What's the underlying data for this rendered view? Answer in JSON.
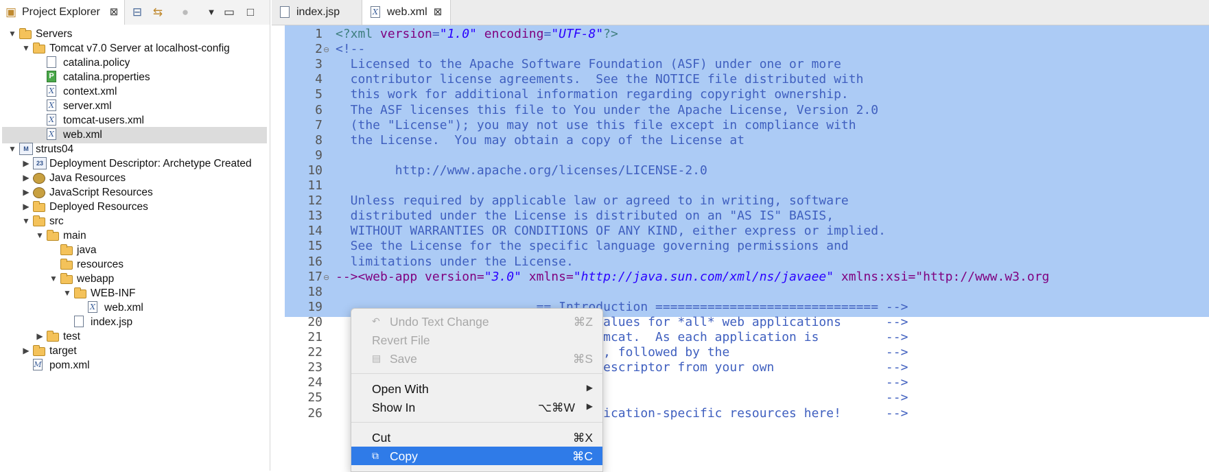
{
  "explorer": {
    "tab_label": "Project Explorer",
    "tree": [
      {
        "label": "Servers",
        "icon": "folder-icon",
        "level": 0,
        "tw": "down"
      },
      {
        "label": "Tomcat v7.0 Server at localhost-config",
        "icon": "folder-icon",
        "level": 1,
        "tw": "down"
      },
      {
        "label": "catalina.policy",
        "icon": "file-icon",
        "level": 2,
        "tw": ""
      },
      {
        "label": "catalina.properties",
        "icon": "properties-file-icon",
        "level": 2,
        "tw": ""
      },
      {
        "label": "context.xml",
        "icon": "xml-file-icon",
        "level": 2,
        "tw": ""
      },
      {
        "label": "server.xml",
        "icon": "xml-file-icon",
        "level": 2,
        "tw": ""
      },
      {
        "label": "tomcat-users.xml",
        "icon": "xml-file-icon",
        "level": 2,
        "tw": ""
      },
      {
        "label": "web.xml",
        "icon": "xml-file-icon",
        "level": 2,
        "tw": "",
        "selected": true
      },
      {
        "label": "struts04",
        "icon": "maven-project-icon",
        "level": 0,
        "tw": "down"
      },
      {
        "label": "Deployment Descriptor: Archetype Created",
        "icon": "deployment-descriptor-icon",
        "level": 1,
        "tw": "right"
      },
      {
        "label": "Java Resources",
        "icon": "java-resources-icon",
        "level": 1,
        "tw": "right"
      },
      {
        "label": "JavaScript Resources",
        "icon": "javascript-resources-icon",
        "level": 1,
        "tw": "right"
      },
      {
        "label": "Deployed Resources",
        "icon": "folder-icon",
        "level": 1,
        "tw": "right"
      },
      {
        "label": "src",
        "icon": "folder-icon",
        "level": 1,
        "tw": "down"
      },
      {
        "label": "main",
        "icon": "folder-icon",
        "level": 2,
        "tw": "down"
      },
      {
        "label": "java",
        "icon": "folder-icon",
        "level": 3,
        "tw": ""
      },
      {
        "label": "resources",
        "icon": "folder-icon",
        "level": 3,
        "tw": ""
      },
      {
        "label": "webapp",
        "icon": "folder-icon",
        "level": 3,
        "tw": "down"
      },
      {
        "label": "WEB-INF",
        "icon": "folder-icon",
        "level": 4,
        "tw": "down"
      },
      {
        "label": "web.xml",
        "icon": "xml-file-icon",
        "level": 5,
        "tw": ""
      },
      {
        "label": "index.jsp",
        "icon": "file-icon",
        "level": 4,
        "tw": ""
      },
      {
        "label": "test",
        "icon": "folder-icon",
        "level": 2,
        "tw": "right"
      },
      {
        "label": "target",
        "icon": "folder-icon",
        "level": 1,
        "tw": "right"
      },
      {
        "label": "pom.xml",
        "icon": "maven-pom-icon",
        "level": 1,
        "tw": ""
      }
    ]
  },
  "editor_tabs": [
    {
      "label": "index.jsp",
      "icon": "file-icon",
      "active": false
    },
    {
      "label": "web.xml",
      "icon": "xml-file-icon",
      "active": true
    }
  ],
  "editor": {
    "lines": [
      {
        "n": "1",
        "text": "<?xml version=\"1.0\" encoding=\"UTF-8\"?>"
      },
      {
        "n": "2",
        "text": "<!--"
      },
      {
        "n": "3",
        "text": "  Licensed to the Apache Software Foundation (ASF) under one or more"
      },
      {
        "n": "4",
        "text": "  contributor license agreements.  See the NOTICE file distributed with"
      },
      {
        "n": "5",
        "text": "  this work for additional information regarding copyright ownership."
      },
      {
        "n": "6",
        "text": "  The ASF licenses this file to You under the Apache License, Version 2.0"
      },
      {
        "n": "7",
        "text": "  (the \"License\"); you may not use this file except in compliance with"
      },
      {
        "n": "8",
        "text": "  the License.  You may obtain a copy of the License at"
      },
      {
        "n": "9",
        "text": ""
      },
      {
        "n": "10",
        "text": "        http://www.apache.org/licenses/LICENSE-2.0"
      },
      {
        "n": "11",
        "text": ""
      },
      {
        "n": "12",
        "text": "  Unless required by applicable law or agreed to in writing, software"
      },
      {
        "n": "13",
        "text": "  distributed under the License is distributed on an \"AS IS\" BASIS,"
      },
      {
        "n": "14",
        "text": "  WITHOUT WARRANTIES OR CONDITIONS OF ANY KIND, either express or implied."
      },
      {
        "n": "15",
        "text": "  See the License for the specific language governing permissions and"
      },
      {
        "n": "16",
        "text": "  limitations under the License."
      },
      {
        "n": "17",
        "text": "--><web-app version=\"3.0\" xmlns=\"http://java.sun.com/xml/ns/javaee\" xmlns:xsi=\"http://www.w3.org"
      },
      {
        "n": "18",
        "text": ""
      },
      {
        "n": "19",
        "text": "                           == Introduction ============================== -->"
      },
      {
        "n": "20",
        "text": "                           default values for *all* web applications      -->"
      },
      {
        "n": "21",
        "text": "                           nce of Tomcat.  As each application is         -->"
      },
      {
        "n": "22",
        "text": "                           processed, followed by the                     -->"
      },
      {
        "n": "23",
        "text": "                           loyment descriptor from your own               -->"
      },
      {
        "n": "24",
        "text": "                                                                          -->"
      },
      {
        "n": "25",
        "text": "                                                                          -->"
      },
      {
        "n": "26",
        "text": "                           gure application-specific resources here!      -->"
      }
    ]
  },
  "context_menu": {
    "items": [
      {
        "label": "Undo Text Change",
        "shortcut": "⌘Z",
        "disabled": true,
        "icon": "undo-icon"
      },
      {
        "label": "Revert File",
        "shortcut": "",
        "disabled": true
      },
      {
        "label": "Save",
        "shortcut": "⌘S",
        "disabled": true,
        "icon": "save-icon"
      },
      {
        "separator": true
      },
      {
        "label": "Open With",
        "shortcut": "",
        "submenu": true
      },
      {
        "label": "Show In",
        "shortcut": "⌥⌘W",
        "submenu": true
      },
      {
        "separator": true
      },
      {
        "label": "Cut",
        "shortcut": "⌘X"
      },
      {
        "label": "Copy",
        "shortcut": "⌘C",
        "highlighted": true,
        "icon": "copy-icon"
      }
    ]
  },
  "colors": {
    "selection": "#accbf5",
    "menu_highlight": "#2f7be8",
    "comment": "#3f5fbf",
    "tag": "#3f7f7f",
    "attr": "#7f007f",
    "string": "#2a00ff"
  }
}
